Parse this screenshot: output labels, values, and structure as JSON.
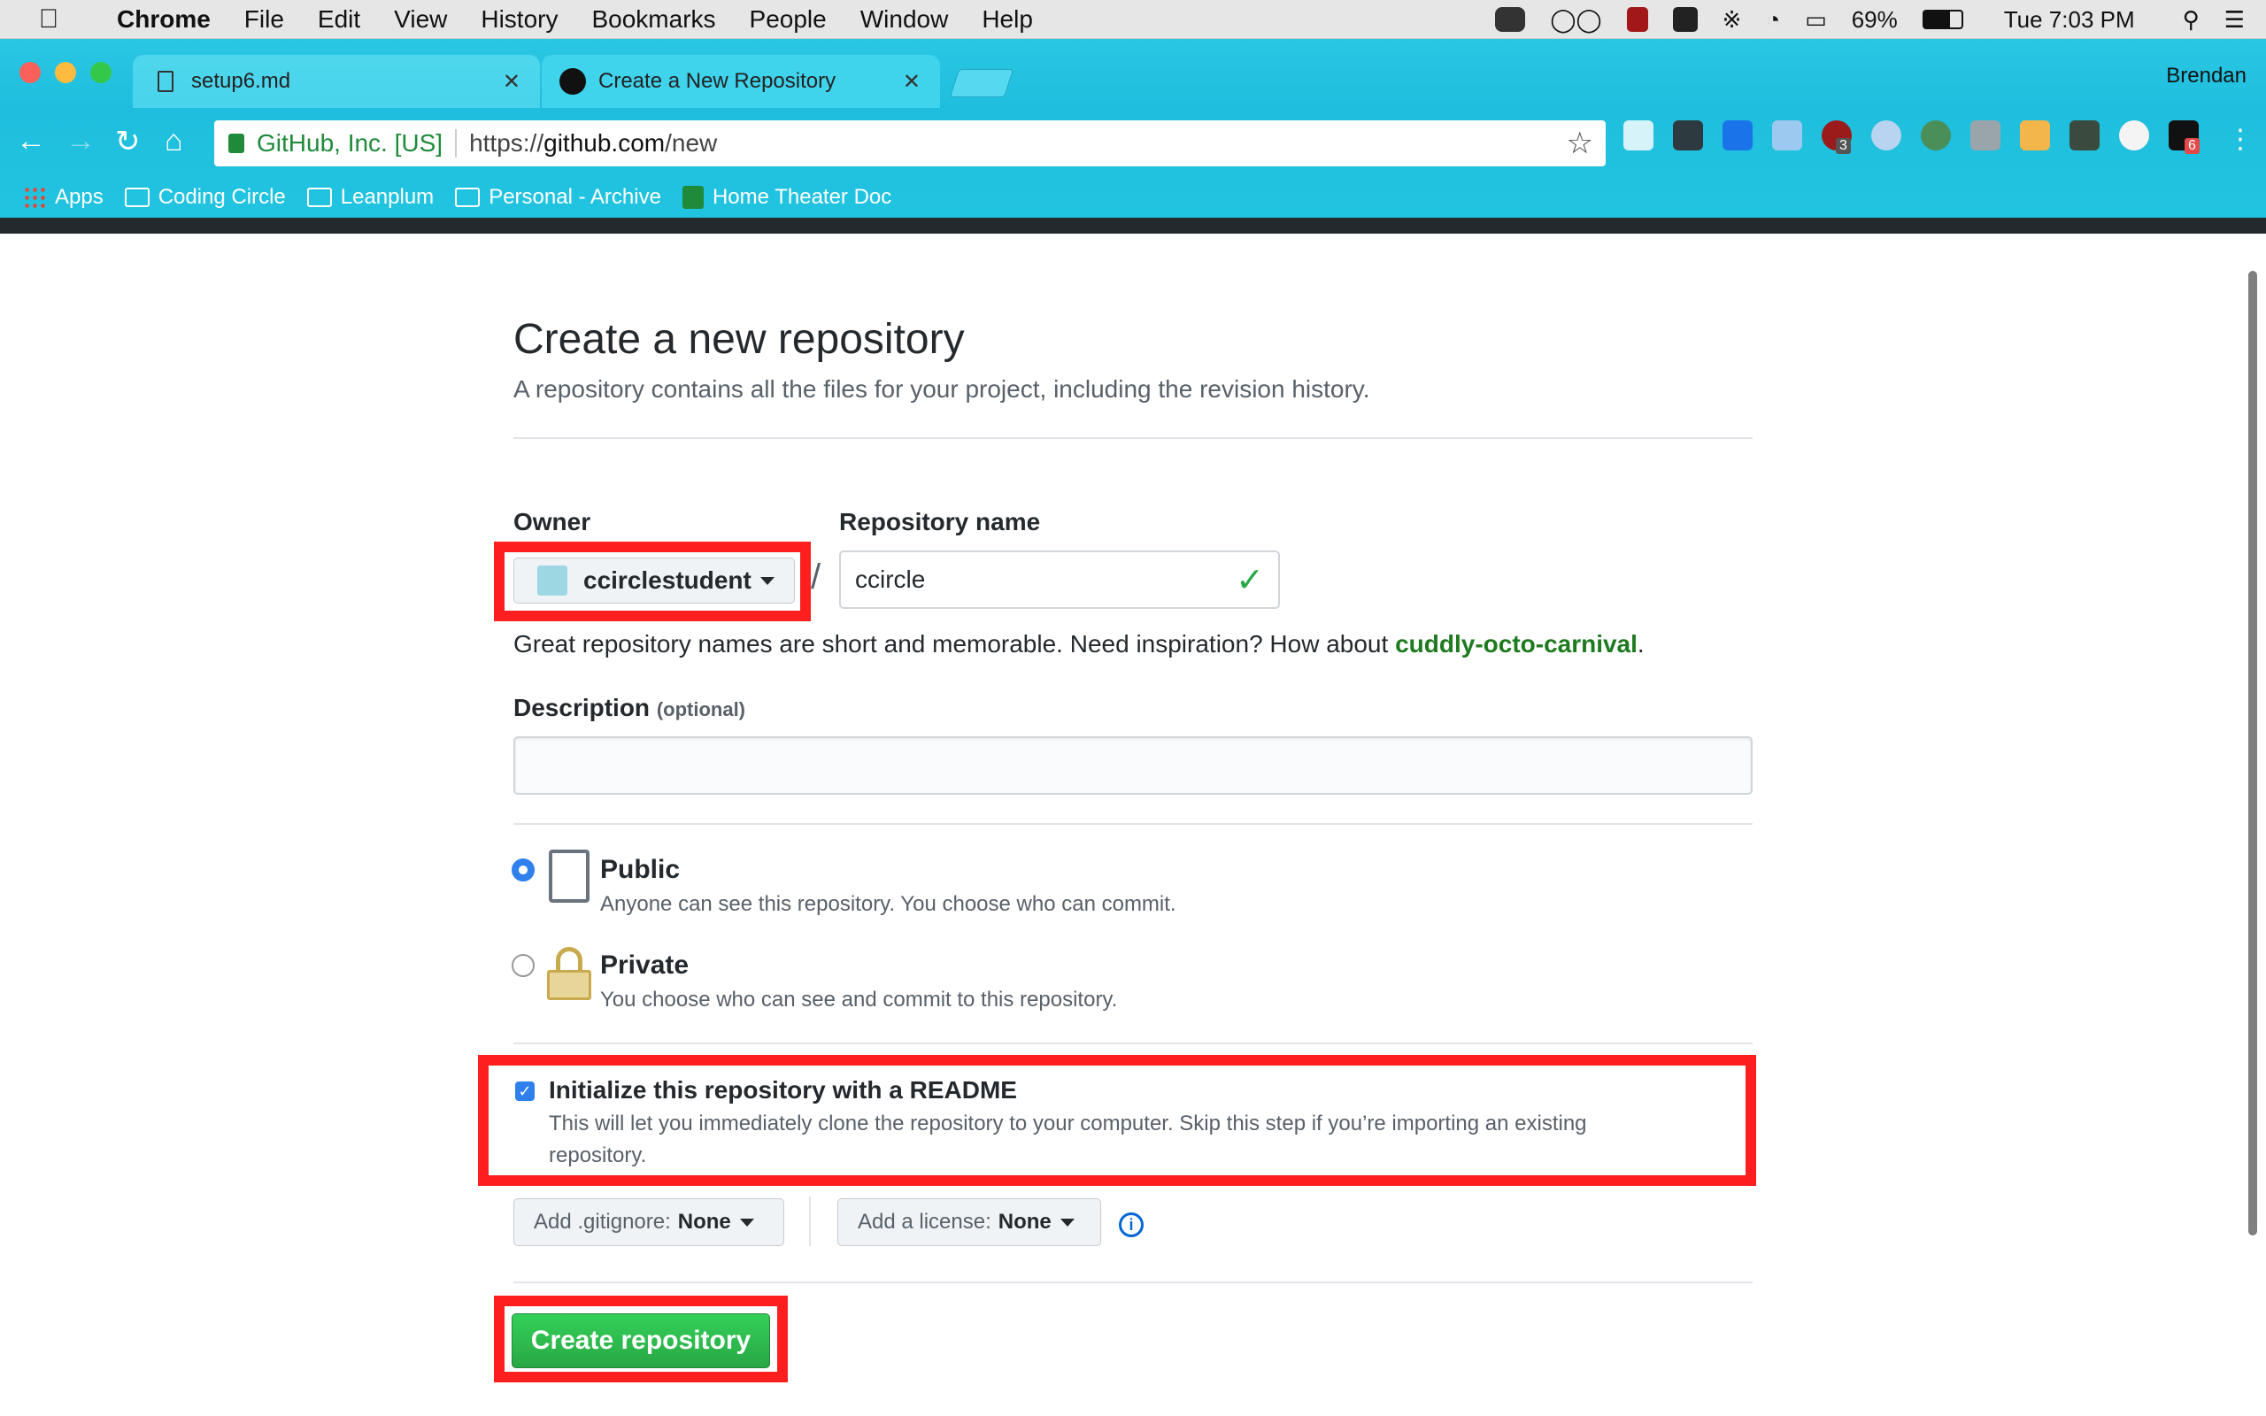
{
  "menubar": {
    "app": "Chrome",
    "items": [
      "File",
      "Edit",
      "View",
      "History",
      "Bookmarks",
      "People",
      "Window",
      "Help"
    ],
    "battery": "69%",
    "clock": "Tue 7:03 PM"
  },
  "browser": {
    "tabs": [
      {
        "title": "setup6.md"
      },
      {
        "title": "Create a New Repository"
      }
    ],
    "profile": "Brendan",
    "secure_label": "GitHub, Inc. [US]",
    "url_scheme": "https://",
    "url_host": "github.com",
    "url_path": "/new",
    "bookmarks": [
      "Apps",
      "Coding Circle",
      "Leanplum",
      "Personal - Archive",
      "Home Theater Doc"
    ],
    "extension_badges": {
      "ublock": "3",
      "amazon": "6"
    }
  },
  "page": {
    "title": "Create a new repository",
    "subtitle": "A repository contains all the files for your project, including the revision history.",
    "owner_label": "Owner",
    "owner_value": "ccirclestudent",
    "slash": "/",
    "repo_label": "Repository name",
    "repo_value": "ccircle",
    "hint_prefix": "Great repository names are short and memorable. Need inspiration? How about ",
    "hint_suggestion": "cuddly-octo-carnival",
    "hint_suffix": ".",
    "description_label": "Description",
    "description_optional": "(optional)",
    "description_value": "",
    "visibility": {
      "selected": "public",
      "public_title": "Public",
      "public_note": "Anyone can see this repository. You choose who can commit.",
      "private_title": "Private",
      "private_note": "You choose who can see and commit to this repository."
    },
    "readme": {
      "checked": true,
      "title": "Initialize this repository with a README",
      "note_line1": "This will let you immediately clone the repository to your computer. Skip this step if you’re importing an existing",
      "note_line2": "repository."
    },
    "gitignore_label": "Add .gitignore:",
    "gitignore_value": "None",
    "license_label": "Add a license:",
    "license_value": "None",
    "create_button": "Create repository"
  },
  "colors": {
    "highlight_red": "#ff1f1f",
    "create_green": "#28a745",
    "suggestion_green": "#1e7a1e",
    "radio_blue": "#2f80ed"
  }
}
